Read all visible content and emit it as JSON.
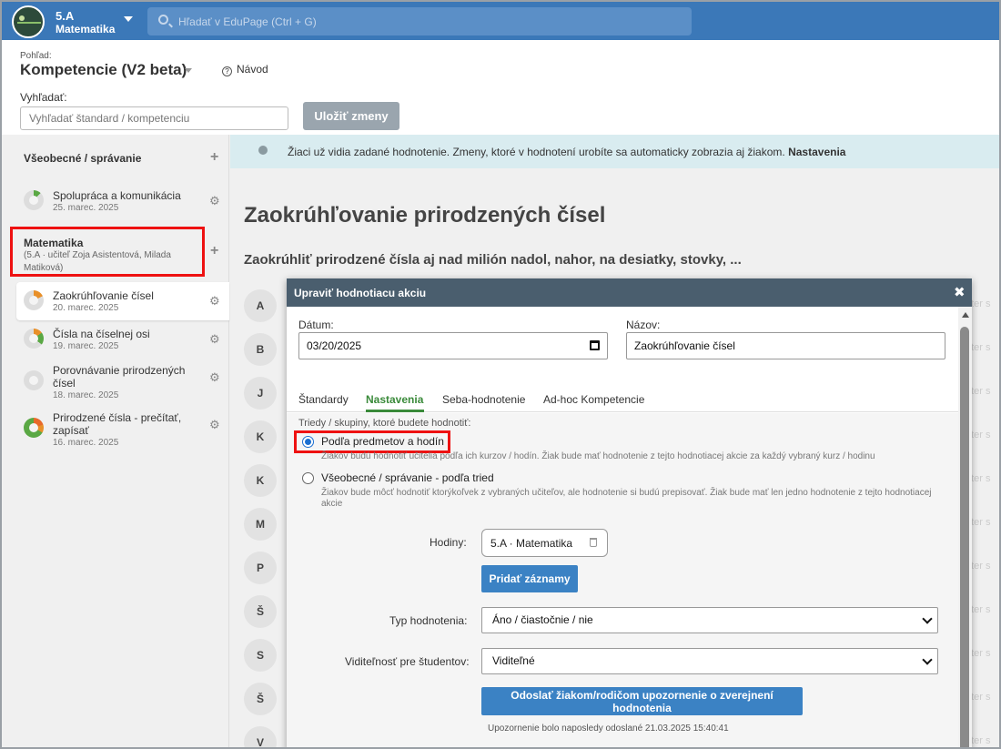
{
  "topbar": {
    "class_name": "5.A",
    "subject_name": "Matematika",
    "search_placeholder": "Hľadať v EduPage (Ctrl + G)"
  },
  "header": {
    "view_label": "Pohľad:",
    "view_title": "Kompetencie (V2 beta)",
    "help_label": "Návod",
    "search_label": "Vyhľadať:",
    "search_placeholder": "Vyhľadať štandard / kompetenciu",
    "save_label": "Uložiť zmeny"
  },
  "sidebar": {
    "general_section": "Všeobecné / správanie",
    "general_items": [
      {
        "title": "Spolupráca a komunikácia",
        "date": "25. marec. 2025"
      }
    ],
    "math_section": {
      "title": "Matematika",
      "subtitle": "(5.A · učiteľ Zoja Asistentová, Milada Matiková)"
    },
    "math_items": [
      {
        "title": "Zaokrúhľovanie čísel",
        "date": "20. marec. 2025"
      },
      {
        "title": "Čísla na číselnej osi",
        "date": "19. marec. 2025"
      },
      {
        "title": "Porovnávanie prirodzených čísel",
        "date": "18. marec. 2025"
      },
      {
        "title": "Prirodzené čísla - prečítať, zapísať",
        "date": "16. marec. 2025"
      }
    ]
  },
  "notice": {
    "text": "Žiaci už vidia zadané hodnotenie. Zmeny, ktoré v hodnotení urobíte sa automaticky zobrazia aj žiakom.",
    "link": "Nastavenia"
  },
  "standard": {
    "title": "Zaokrúhľovanie prirodzených čísel",
    "subtitle": "Zaokrúhliť prirodzené čísla aj nad milión nadol, nahor, na desiatky, stovky, ..."
  },
  "student_letters": [
    "A",
    "B",
    "J",
    "K",
    "K",
    "M",
    "P",
    "Š",
    "S",
    "Š",
    "V"
  ],
  "ghost_text": "nter s",
  "modal": {
    "title": "Upraviť hodnotiacu akciu",
    "date_label": "Dátum:",
    "date_value": "03/20/2025",
    "name_label": "Názov:",
    "name_value": "Zaokrúhľovanie čísel",
    "tabs": [
      "Štandardy",
      "Nastavenia",
      "Seba-hodnotenie",
      "Ad-hoc Kompetencie"
    ],
    "active_tab": "Nastavenia",
    "groups_label": "Triedy / skupiny, ktoré budete hodnotiť:",
    "option1_title": "Podľa predmetov a hodín",
    "option1_desc": "Žiakov budú hodnotiť učitelia podľa ich kurzov / hodín. Žiak bude mať hodnotenie z tejto hodnotiacej akcie za každý vybraný kurz / hodinu",
    "option2_title": "Všeobecné / správanie - podľa tried",
    "option2_desc": "Žiakov bude môcť hodnotiť ktorýkoľvek z vybraných učiteľov, ale hodnotenie si budú prepisovať. Žiak bude mať len jedno hodnotenie z tejto hodnotiacej akcie",
    "hours_label": "Hodiny:",
    "hours_chip": "5.A · Matematika",
    "add_records": "Pridať záznamy",
    "type_label": "Typ hodnotenia:",
    "type_value": "Áno / čiastočnie / nie",
    "visibility_label": "Viditeľnosť pre študentov:",
    "visibility_value": "Viditeľné",
    "notify_button": "Odoslať žiakom/rodičom upozornenie o zverejnení hodnotenia",
    "notify_note": "Upozornenie bolo naposledy odoslané 21.03.2025 15:40:41"
  },
  "colors": {
    "topbar": "#3b78b8",
    "accent_green": "#3a8a3a",
    "button_blue": "#3b82c4",
    "highlight_red": "#ee1111",
    "modal_header": "#4a5e6e"
  }
}
